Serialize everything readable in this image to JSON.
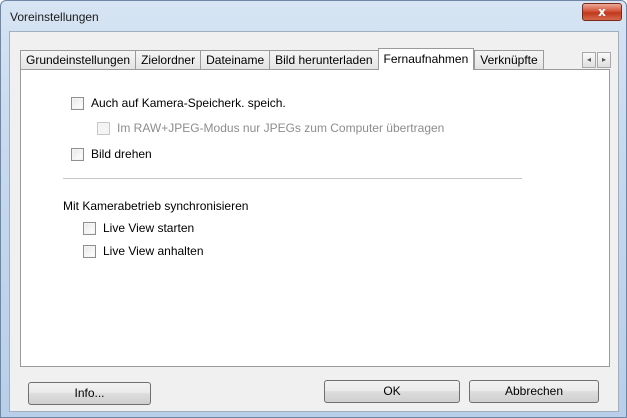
{
  "window": {
    "title": "Voreinstellungen",
    "close_glyph": "x"
  },
  "tabs": [
    {
      "label": "Grundeinstellungen",
      "active": false
    },
    {
      "label": "Zielordner",
      "active": false
    },
    {
      "label": "Dateiname",
      "active": false
    },
    {
      "label": "Bild herunterladen",
      "active": false
    },
    {
      "label": "Fernaufnahmen",
      "active": true
    },
    {
      "label": "Verknüpfte",
      "active": false
    }
  ],
  "tab_scroll": {
    "left": "◂",
    "right": "▸"
  },
  "options": {
    "save_to_card": {
      "label": "Auch auf Kamera-Speicherk. speich.",
      "checked": false,
      "enabled": true
    },
    "raw_jpeg_only": {
      "label": "Im RAW+JPEG-Modus nur JPEGs zum Computer übertragen",
      "checked": false,
      "enabled": false
    },
    "rotate_image": {
      "label": "Bild drehen",
      "checked": false,
      "enabled": true
    }
  },
  "sync_section": {
    "label": "Mit Kamerabetrieb synchronisieren",
    "live_view_start": {
      "label": "Live View starten",
      "checked": false
    },
    "live_view_stop": {
      "label": "Live View anhalten",
      "checked": false
    }
  },
  "buttons": {
    "info": "Info...",
    "ok": "OK",
    "cancel": "Abbrechen"
  }
}
